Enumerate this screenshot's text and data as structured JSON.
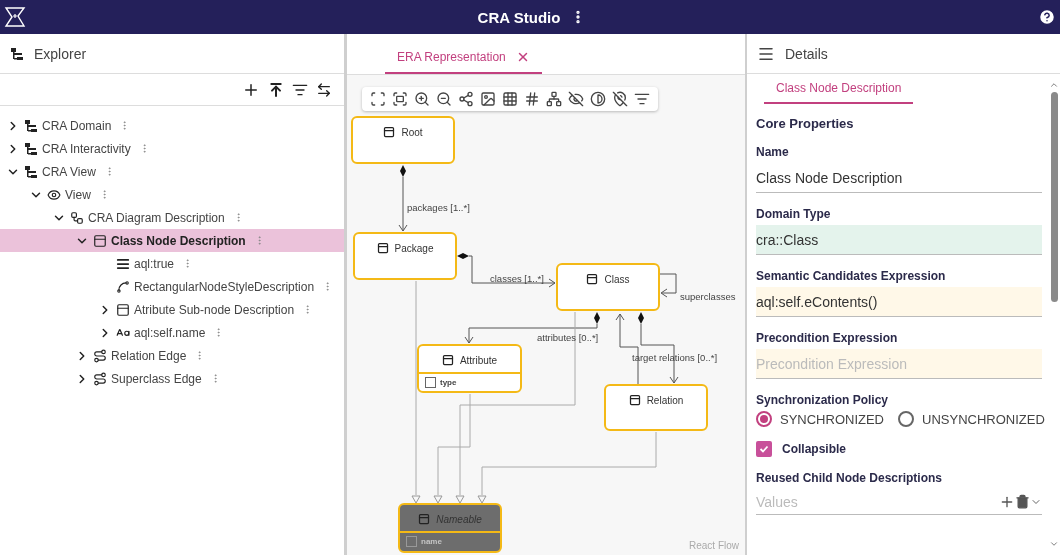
{
  "app": {
    "title": "CRA Studio"
  },
  "explorer": {
    "title": "Explorer",
    "tree": [
      {
        "label": "CRA Domain",
        "kind": "model",
        "expanded": false,
        "selected": false
      },
      {
        "label": "CRA Interactivity",
        "kind": "model",
        "expanded": false,
        "selected": false
      },
      {
        "label": "CRA View",
        "kind": "model",
        "expanded": true,
        "selected": false,
        "children": [
          {
            "label": "View",
            "kind": "view",
            "expanded": true,
            "selected": false,
            "children": [
              {
                "label": "CRA Diagram Description",
                "kind": "diagram",
                "expanded": true,
                "selected": false,
                "children": [
                  {
                    "label": "Class Node Description",
                    "kind": "node",
                    "expanded": true,
                    "selected": true,
                    "children": [
                      {
                        "label": "aql:true",
                        "kind": "condition",
                        "selected": false
                      },
                      {
                        "label": "RectangularNodeStyleDescription",
                        "kind": "style",
                        "selected": false
                      },
                      {
                        "label": "Atribute Sub-node Description",
                        "kind": "node",
                        "expanded": false,
                        "selected": false
                      },
                      {
                        "label": "aql:self.name",
                        "kind": "label",
                        "expanded": false,
                        "selected": false
                      }
                    ]
                  },
                  {
                    "label": "Relation Edge",
                    "kind": "edge",
                    "expanded": false,
                    "selected": false
                  },
                  {
                    "label": "Superclass Edge",
                    "kind": "edge",
                    "expanded": false,
                    "selected": false
                  }
                ]
              }
            ]
          }
        ]
      }
    ]
  },
  "editor": {
    "tabs": [
      {
        "label": "ERA Representation",
        "selected": true
      }
    ],
    "nodes": [
      {
        "label": "Root",
        "kind": "class"
      },
      {
        "label": "Package",
        "kind": "class"
      },
      {
        "label": "Class",
        "kind": "class"
      },
      {
        "label": "Attribute",
        "kind": "class",
        "attributes": [
          "type"
        ]
      },
      {
        "label": "Relation",
        "kind": "class"
      },
      {
        "label": "Nameable",
        "kind": "abstract",
        "attributes": [
          "name"
        ]
      }
    ],
    "edge_labels": [
      "packages [1..*]",
      "classes [1..*]",
      "superclasses",
      "attributes [0..*]",
      "target relations [0..*]"
    ],
    "attribution": "React Flow"
  },
  "details": {
    "title": "Details",
    "tabs": [
      {
        "label": "Class Node Description",
        "selected": true
      }
    ],
    "section": "Core Properties",
    "fields": [
      {
        "kind": "text",
        "label": "Name",
        "value": "Class Node Description"
      },
      {
        "kind": "domain",
        "label": "Domain Type",
        "value": "cra::Class"
      },
      {
        "kind": "expression",
        "label": "Semantic Candidates Expression",
        "value": "aql:self.eContents()"
      },
      {
        "kind": "expression",
        "label": "Precondition Expression",
        "placeholder": "Precondition Expression"
      },
      {
        "kind": "radio",
        "label": "Synchronization Policy",
        "options": [
          {
            "label": "SYNCHRONIZED",
            "selected": true
          },
          {
            "label": "UNSYNCHRONIZED",
            "selected": false
          }
        ]
      },
      {
        "kind": "checkbox",
        "label": "Collapsible",
        "checked": true
      },
      {
        "kind": "list",
        "label": "Reused Child Node Descriptions",
        "placeholder": "Values"
      }
    ]
  }
}
